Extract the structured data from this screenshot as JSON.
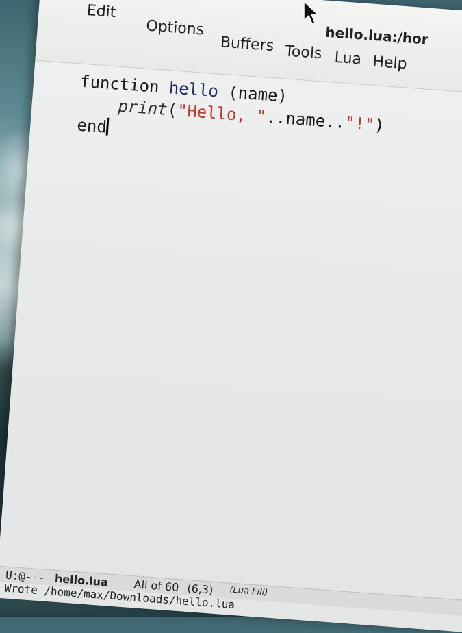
{
  "window": {
    "title": "hello.lua:/hor"
  },
  "menu": {
    "items": [
      "Edit",
      "Options",
      "Buffers",
      "Tools",
      "Lua",
      "Help"
    ]
  },
  "editor": {
    "line1": {
      "keyword": "function",
      "name": "hello",
      "args": " (name)"
    },
    "line2": {
      "indent": "    ",
      "call": "print",
      "open": "(",
      "str1": "\"Hello, \"",
      "concat": "..name..",
      "str2": "\"!\"",
      "close": ")"
    },
    "line3": {
      "keyword": "end"
    }
  },
  "modeline": {
    "status": "U:@---",
    "buffer": "hello.lua",
    "position": "All of 60",
    "cursor": "(6,3)",
    "mode": "(Lua Fill)"
  },
  "echo_area": {
    "message": "Wrote /home/max/Downloads/hello.lua"
  },
  "colors": {
    "function_name": "#1e2b70",
    "string": "#c0392b"
  },
  "icons": {
    "pointer": "mouse-pointer-icon"
  }
}
